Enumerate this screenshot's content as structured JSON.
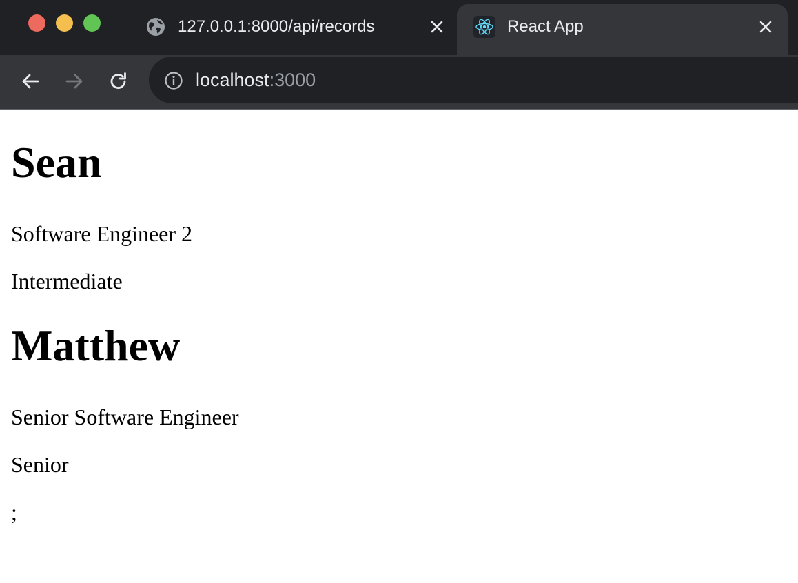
{
  "window": {
    "controls": {
      "close_color": "#ed6a5e",
      "minimize_color": "#f5bf4f",
      "maximize_color": "#61c454"
    }
  },
  "tabs": [
    {
      "title": "127.0.0.1:8000/api/records",
      "icon": "globe-icon",
      "active": false
    },
    {
      "title": "React App",
      "icon": "react-logo-icon",
      "active": true
    }
  ],
  "toolbar": {
    "back_icon": "back-arrow-icon",
    "forward_icon": "forward-arrow-icon",
    "reload_icon": "reload-icon",
    "site_info_icon": "info-icon"
  },
  "address_bar": {
    "host": "localhost",
    "port": ":3000"
  },
  "records": [
    {
      "name": "Sean",
      "title": "Software Engineer 2",
      "level": "Intermediate"
    },
    {
      "name": "Matthew",
      "title": "Senior Software Engineer",
      "level": "Senior"
    }
  ],
  "trailing_text": ";"
}
